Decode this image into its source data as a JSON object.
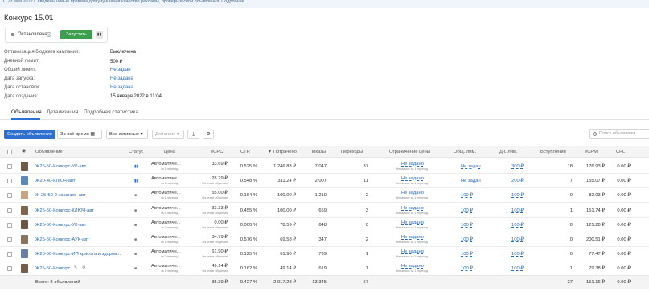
{
  "banner": "С 23 мая 2022 г. введены новые правила для улучшения качества рекламы, проверьте свои объявления. Подробнее.",
  "campaign": {
    "title": "Конкурс 15.01",
    "status": "Остановлена",
    "run_label": "Запустить",
    "info": [
      {
        "label": "Оптимизация бюджета кампании:",
        "value": "Выключена",
        "link": false
      },
      {
        "label": "Дневной лимит:",
        "value": "500 ₽",
        "link": false
      },
      {
        "label": "Общий лимит:",
        "value": "Не задан",
        "link": true
      },
      {
        "label": "Дата запуска:",
        "value": "Не задана",
        "link": true
      },
      {
        "label": "Дата остановки:",
        "value": "Не задана",
        "link": true
      },
      {
        "label": "Дата создания:",
        "value": "15 января 2022 в 11:04",
        "link": false
      }
    ]
  },
  "tabs": [
    "Объявления",
    "Детализация",
    "Подробная статистика"
  ],
  "toolbar": {
    "create": "Создать объявление",
    "period": "За всё время",
    "filter": "Все активные",
    "actions": "Действия",
    "search_placeholder": "Поиск объявлени"
  },
  "table": {
    "headers": {
      "ad": "Объявление",
      "status": "Статус",
      "price": "Цена",
      "ecpc": "eCPC",
      "ctr": "CTR",
      "spent": "Потрачено",
      "shows": "Показы",
      "clicks": "Переходы",
      "limit": "Ограничение цены",
      "total_limit": "Общ. лим.",
      "day_limit": "Дн. лим.",
      "joined": "Вступления",
      "ecpm": "eCPM",
      "cpl": "CPL"
    },
    "rows": [
      {
        "name": "Ж25-50-Конкурс-УК-авт",
        "status": "pause",
        "price": "Автоматиче...",
        "price_sub": "за 1 переход",
        "ecpc": "33.69 ₽",
        "ecpc_sub": "",
        "ctr": "0.525 %",
        "spent": "1 246.83 ₽",
        "shows": "7 047",
        "clicks": "37",
        "limit": "Не задано",
        "limit_sub": "Желаемое за 1 переход",
        "total": "Не задан",
        "day": "300 ₽",
        "joined": "18",
        "ecpm": "176.93 ₽",
        "cpl": "0.00 ₽",
        "thumb": "#6e5a4a"
      },
      {
        "name": "Ж20-40-КЛЮЧ-авт",
        "status": "pause",
        "price": "Автоматиче...",
        "price_sub": "за 1 переход",
        "ecpc": "28.29 ₽",
        "ecpc_sub": "На этапе обучения",
        "ctr": "0.548 %",
        "spent": "311.24 ₽",
        "shows": "2 007",
        "clicks": "11",
        "limit": "Не задано",
        "limit_sub": "Желаемое за 1 переход",
        "total": "Не задан",
        "day": "200 ₽",
        "joined": "7",
        "ecpm": "155.07 ₽",
        "cpl": "0.00 ₽",
        "thumb": "#5f87b6"
      },
      {
        "name": "Ж 25-50-2 касание -авт",
        "status": "stop",
        "price": "Автоматиче...",
        "price_sub": "за 1 переход",
        "ecpc": "55.00 ₽",
        "ecpc_sub": "На этапе обучения",
        "ctr": "0.164 %",
        "spent": "100.00 ₽",
        "shows": "1 219",
        "clicks": "2",
        "limit": "Не задано",
        "limit_sub": "Желаемое за 1 переход",
        "total": "100 ₽",
        "day": "100 ₽",
        "joined": "0",
        "ecpm": "82.03 ₽",
        "cpl": "0.00 ₽",
        "thumb": "#c3a68a"
      },
      {
        "name": "Ж25-50-Конкурс-КЛЮЧ-авт",
        "status": "stop",
        "price": "Автоматиче...",
        "price_sub": "за 1 переход",
        "ecpc": "33.33 ₽",
        "ecpc_sub": "На этапе обучения",
        "ctr": "0.455 %",
        "spent": "100.00 ₽",
        "shows": "659",
        "clicks": "3",
        "limit": "Не задано",
        "limit_sub": "Желаемое за 1 переход",
        "total": "100 ₽",
        "day": "100 ₽",
        "joined": "1",
        "ecpm": "151.74 ₽",
        "cpl": "0.00 ₽",
        "thumb": "#7c6652"
      },
      {
        "name": "Ж25-50-Конкурс-УК-авт",
        "status": "stop",
        "price": "Автоматиче...",
        "price_sub": "за 1 переход",
        "ecpc": "0.00 ₽",
        "ecpc_sub": "На этапе обучения",
        "ctr": "0.000 %",
        "spent": "78.59 ₽",
        "shows": "648",
        "clicks": "0",
        "limit": "Не задано",
        "limit_sub": "Желаемое за 1 переход",
        "total": "100 ₽",
        "day": "100 ₽",
        "joined": "0",
        "ecpm": "121.28 ₽",
        "cpl": "0.00 ₽",
        "thumb": "#6b5646"
      },
      {
        "name": "Ж25-50-Конкурс-АУК-авт",
        "status": "stop",
        "price": "Автоматиче...",
        "price_sub": "за 1 переход",
        "ecpc": "34.79 ₽",
        "ecpc_sub": "На этапе обучения",
        "ctr": "0.576 %",
        "spent": "69.58 ₽",
        "shows": "347",
        "clicks": "2",
        "limit": "Не задано",
        "limit_sub": "Желаемое за 1 переход",
        "total": "100 ₽",
        "day": "100 ₽",
        "joined": "0",
        "ecpm": "200.51 ₽",
        "cpl": "0.00 ₽",
        "thumb": "#8a7260"
      },
      {
        "name": "Ж25-50-Конкурс-ИП красота и здоров...",
        "status": "stop",
        "price": "Автоматиче...",
        "price_sub": "за 1 переход",
        "ecpc": "61.90 ₽",
        "ecpc_sub": "На этапе обучения",
        "ctr": "0.125 %",
        "spent": "61.90 ₽",
        "shows": "799",
        "clicks": "1",
        "limit": "Не задано",
        "limit_sub": "Желаемое за 1 переход",
        "total": "100 ₽",
        "day": "100 ₽",
        "joined": "0",
        "ecpm": "77.47 ₽",
        "cpl": "0.00 ₽",
        "thumb": "#6a7fa0"
      },
      {
        "name": "Ж25-50-Конкурс",
        "status": "stop",
        "price": "Автоматиче...",
        "price_sub": "за 1 переход",
        "ecpc": "49.14 ₽",
        "ecpc_sub": "На этапе обучения",
        "ctr": "0.162 %",
        "spent": "49.14 ₽",
        "shows": "619",
        "clicks": "1",
        "limit": "Не задано",
        "limit_sub": "Желаемое за 1 переход",
        "total": "100 ₽",
        "day": "100 ₽",
        "joined": "1",
        "ecpm": "79.38 ₽",
        "cpl": "0.00 ₽",
        "thumb": "#735e4e"
      }
    ],
    "footer": {
      "label": "Всего: 8 объявлений",
      "ecpc": "35.39 ₽",
      "ctr": "0.427 %",
      "spent": "2 017.28 ₽",
      "shows": "13 345",
      "clicks": "57",
      "joined": "27",
      "ecpm": "151.16 ₽",
      "cpl": "0.00 ₽"
    }
  }
}
